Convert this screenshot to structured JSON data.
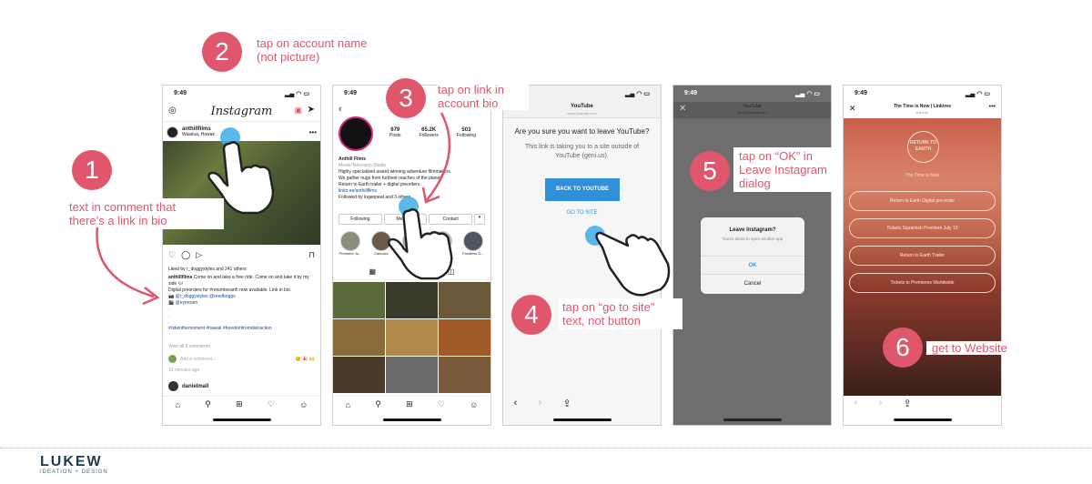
{
  "steps": [
    {
      "number": "1",
      "lines": [
        "text in comment that",
        "there’s a link in bio"
      ]
    },
    {
      "number": "2",
      "lines": [
        "tap on account name",
        "(not picture)"
      ]
    },
    {
      "number": "3",
      "lines": [
        "tap on link in",
        "account bio"
      ]
    },
    {
      "number": "4",
      "lines": [
        "tap on “go to site”",
        "text, not button"
      ]
    },
    {
      "number": "5",
      "lines": [
        "tap on “OK” in",
        "Leave Instagram",
        "dialog"
      ]
    },
    {
      "number": "6",
      "lines": [
        "get to Website"
      ]
    }
  ],
  "screen1": {
    "time": "9:49",
    "app_title": "Instagram",
    "username": "anthillfilms",
    "location": "Waialua, Hawaii",
    "likes": "Liked by r_doggystyles and 241 others",
    "caption_user": "anthillfilms",
    "caption": "Come on and take a free ride. Come on and take it by my side 🎶",
    "caption2": "Digital preorders for #returntoearth now available. Link in bio.",
    "tags1": "📷 @r_doggystyles @reedboggs",
    "tags2": "🎬 @eyeroam",
    "hashtags": "#rideinthemoment #hawaii #freedomfromdistraction",
    "view_comments": "View all 3 comments",
    "add_comment": "Add a comment...",
    "time_ago": "19 minutes ago",
    "next_user": "danielmall"
  },
  "screen2": {
    "time": "9:49",
    "posts_count": "679",
    "posts_label": "Posts",
    "followers_count": "65.2K",
    "followers_label": "Followers",
    "following_count": "503",
    "following_label": "Following",
    "name": "Anthill Films",
    "category": "Movie/Television Studio",
    "bio1": "Highly specialized award-winning adventure filmmakers.",
    "bio2": "We gather nugs from furthest reaches of the planet.",
    "bio3": "Return to Earth trailer + digital preorders",
    "link": "linktr.ee/anthillfilms",
    "followed_by": "Followed by loganpeat and 3 others",
    "btn_following": "Following",
    "btn_message": "Message",
    "btn_contact": "Contact",
    "highlights": [
      "Premiere Ju...",
      "Canucks",
      "",
      "",
      "Foodless D..."
    ]
  },
  "screen3": {
    "site_title": "YouTube",
    "site_url": "www.youtube.com",
    "question": "Are you sure you want to leave YouTube?",
    "explain": "This link is taking you to a site outside of YouTube (geni.us).",
    "back_button": "BACK TO YOUTUBE",
    "go_link": "GO TO SITE"
  },
  "screen4": {
    "time": "9:49",
    "site_title": "YouTube",
    "site_url": "www.youtube.com",
    "dialog_title": "Leave Instagram?",
    "dialog_text": "You're about to open another app",
    "ok": "OK",
    "cancel": "Cancel"
  },
  "screen5": {
    "time": "9:49",
    "page_title": "The Time is Now | Linktree",
    "page_url": "linktr.ee",
    "logo_text": "RETURN TO EARTH",
    "tagline": "The Time is Now",
    "links": [
      "Return to Earth Digital pre-order",
      "Tickets Squamish Premiere July 12",
      "Return to Earth Trailer",
      "Tickets to Premieres Worldwide"
    ]
  },
  "footer": {
    "brand": "LUKEW",
    "sub": "IDEATION + DESIGN"
  },
  "colors": {
    "accent": "#e0566d",
    "tap": "#3eaee6",
    "ig_blue": "#3897f0"
  }
}
